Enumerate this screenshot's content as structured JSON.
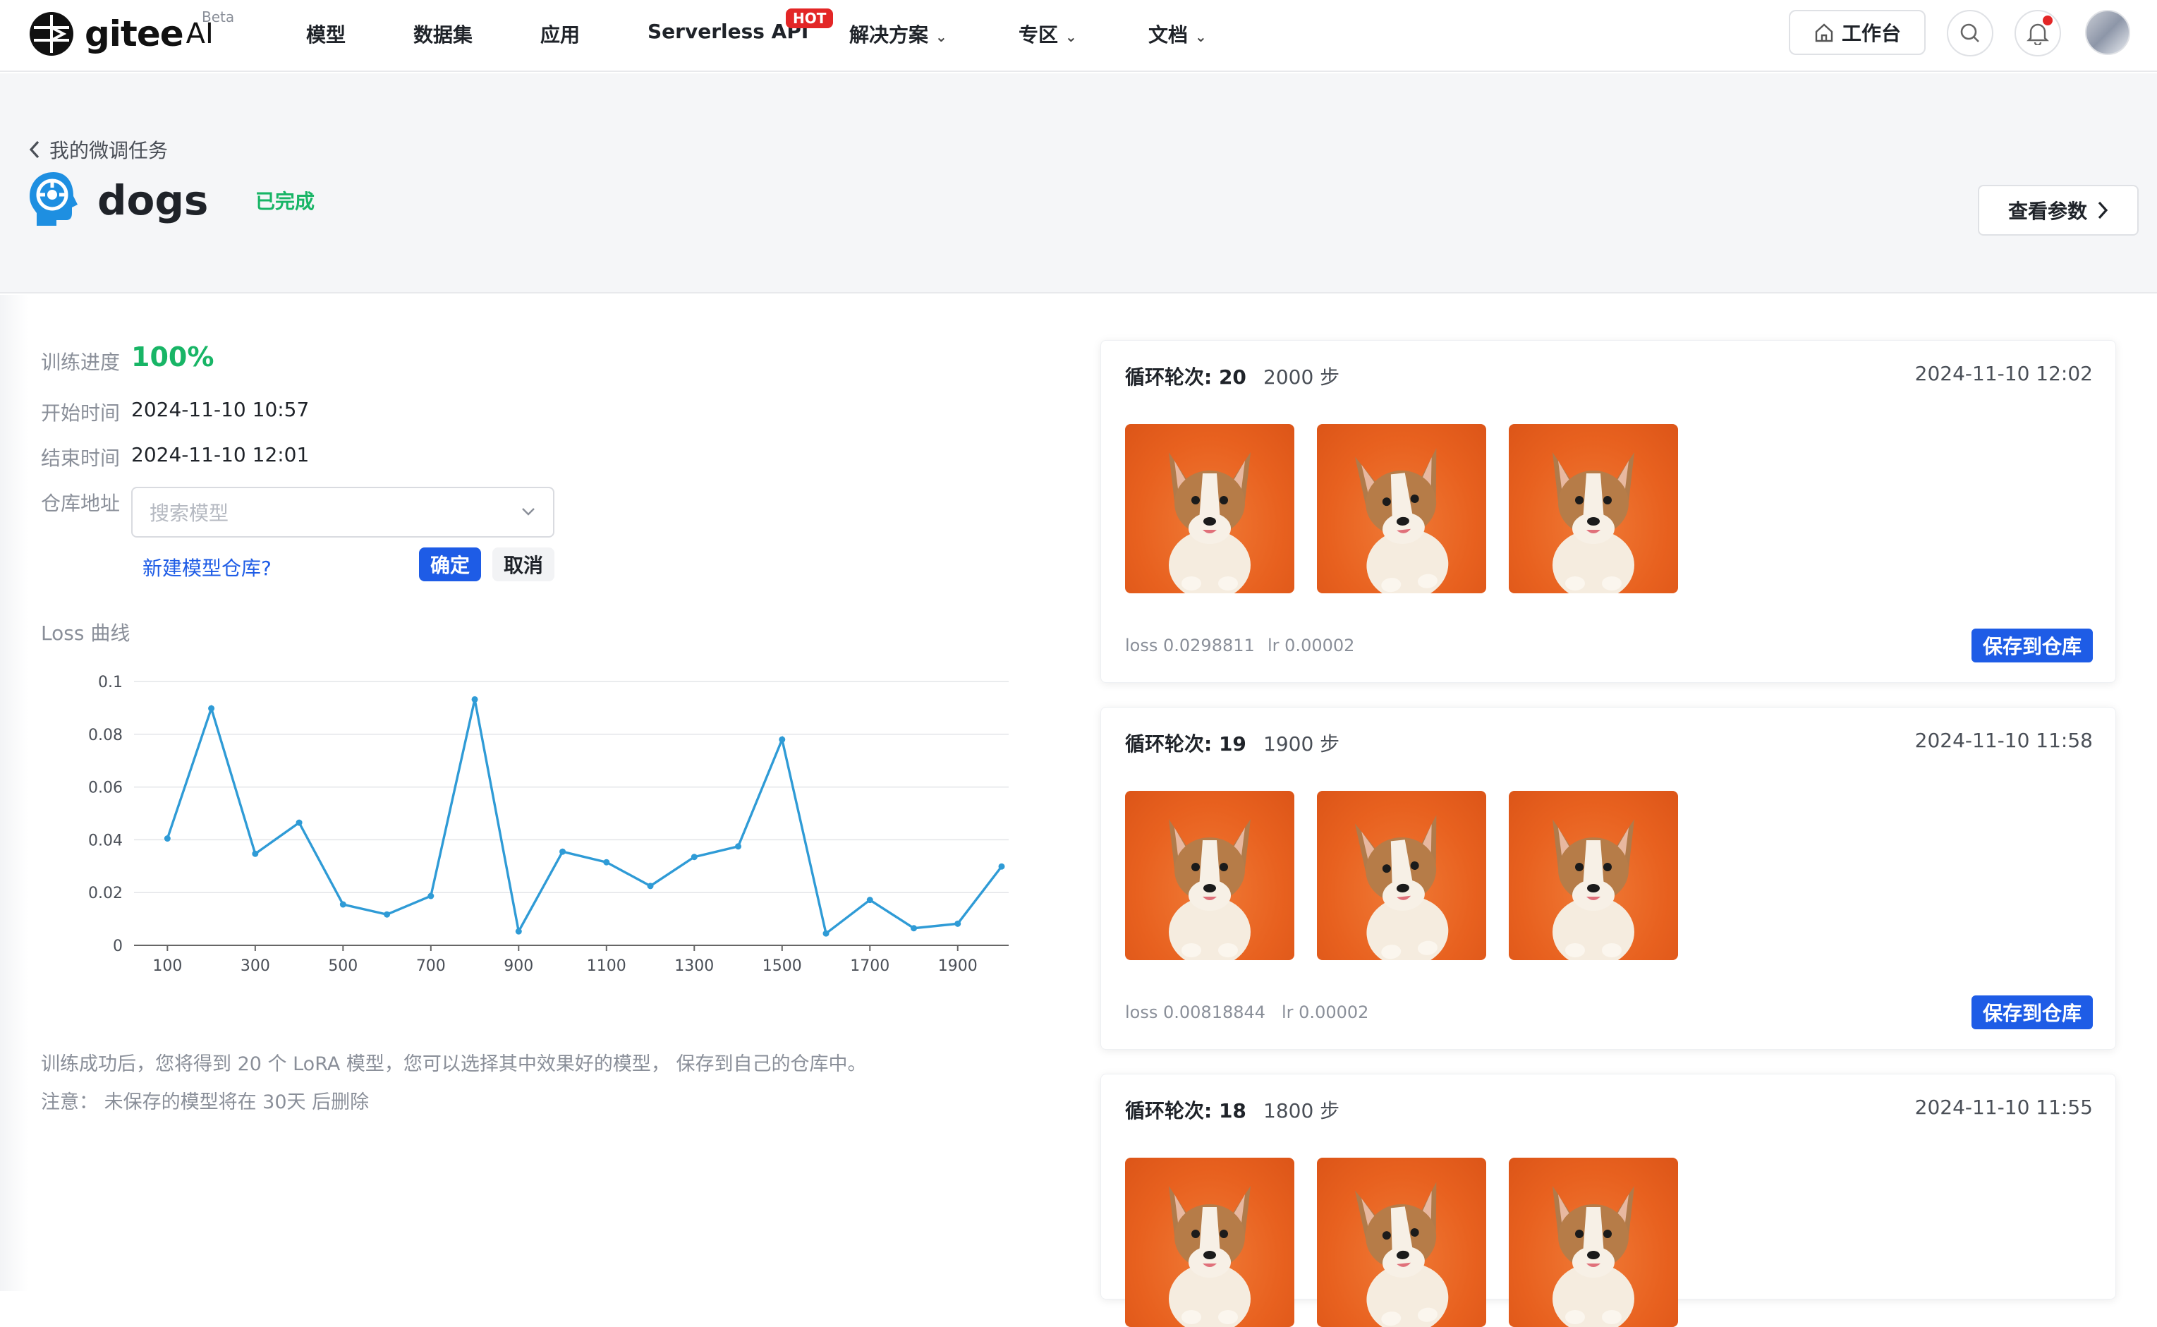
{
  "nav": {
    "logo_text": "gitee",
    "logo_ai": "AI",
    "beta": "Beta",
    "items": [
      {
        "label": "模型"
      },
      {
        "label": "数据集"
      },
      {
        "label": "应用"
      },
      {
        "label": "Serverless API"
      },
      {
        "label": "解决方案"
      },
      {
        "label": "专区"
      },
      {
        "label": "文档"
      }
    ],
    "hot_badge": "HOT",
    "workbench": "工作台"
  },
  "header": {
    "back_label": "我的微调任务",
    "title": "dogs",
    "status": "已完成",
    "view_params": "查看参数"
  },
  "info": {
    "progress_label": "训练进度",
    "progress_value": "100%",
    "start_label": "开始时间",
    "start_value": "2024-11-10 10:57",
    "end_label": "结束时间",
    "end_value": "2024-11-10 12:01",
    "repo_label": "仓库地址",
    "repo_placeholder": "搜索模型",
    "new_repo": "新建模型仓库?",
    "confirm": "确定",
    "cancel": "取消"
  },
  "chart_title": "Loss 曲线",
  "chart_data": {
    "type": "line",
    "title": "Loss 曲线",
    "x": [
      100,
      200,
      300,
      400,
      500,
      600,
      700,
      800,
      900,
      1000,
      1100,
      1200,
      1300,
      1400,
      1500,
      1600,
      1700,
      1800,
      1900,
      2000
    ],
    "series": [
      {
        "values": [
          0.0405,
          0.0898,
          0.0347,
          0.0465,
          0.0155,
          0.0117,
          0.0187,
          0.0932,
          0.0053,
          0.0355,
          0.0315,
          0.0225,
          0.0335,
          0.0375,
          0.078,
          0.0045,
          0.0172,
          0.0065,
          0.0082,
          0.0298811
        ]
      }
    ],
    "x_ticks": [
      100,
      300,
      500,
      700,
      900,
      1100,
      1300,
      1500,
      1700,
      1900
    ],
    "y_ticks": [
      0,
      0.02,
      0.04,
      0.06,
      0.08,
      0.1
    ],
    "y_tick_labels": [
      "0",
      "0.02",
      "0.04",
      "0.06",
      "0.08",
      "0.1"
    ],
    "ylim": [
      0,
      0.1
    ],
    "xlim": [
      100,
      2000
    ],
    "grid": true,
    "line_color": "#2f9bd6"
  },
  "notes": {
    "line1": "训练成功后，您将得到 20 个 LoRA 模型，您可以选择其中效果好的模型， 保存到自己的仓库中。",
    "line2": "注意： 未保存的模型将在 30天 后删除"
  },
  "checkpoints": [
    {
      "epoch": "循环轮次: 20",
      "steps": "2000 步",
      "time": "2024-11-10 12:02",
      "loss": "loss 0.0298811",
      "lr": "lr 0.00002",
      "save": "保存到仓库"
    },
    {
      "epoch": "循环轮次: 19",
      "steps": "1900 步",
      "time": "2024-11-10 11:58",
      "loss": "loss 0.00818844",
      "lr": "lr 0.00002",
      "save": "保存到仓库"
    },
    {
      "epoch": "循环轮次: 18",
      "steps": "1800 步",
      "time": "2024-11-10 11:55",
      "loss": "",
      "lr": "",
      "save": ""
    }
  ],
  "colors": {
    "accent": "#1e5ce6",
    "success": "#18b566",
    "hot": "#e32626",
    "thumb_bg": "#e8611f"
  }
}
